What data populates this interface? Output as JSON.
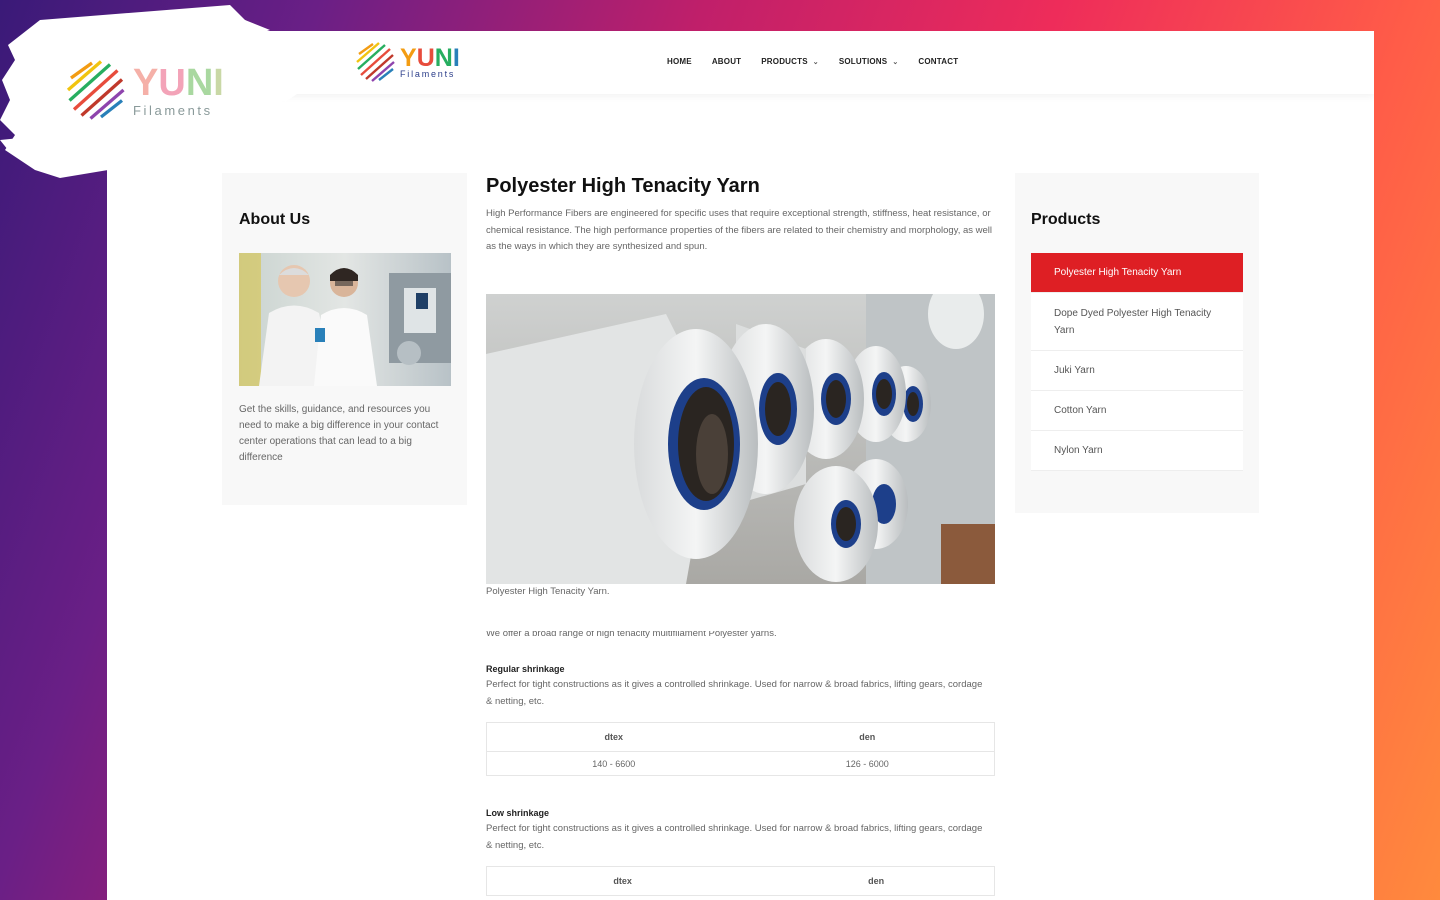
{
  "brand": {
    "name": "YUNI",
    "sub": "Filaments",
    "colors": {
      "y": "#f39c12",
      "u": "#e74c3c",
      "n": "#27ae60",
      "i": "#2980b9",
      "text": "#2c3e8a",
      "accent": "#de1f24"
    }
  },
  "nav": {
    "items": [
      {
        "label": "HOME",
        "dropdown": false
      },
      {
        "label": "ABOUT",
        "dropdown": false
      },
      {
        "label": "PRODUCTS",
        "dropdown": true
      },
      {
        "label": "SOLUTIONS",
        "dropdown": true
      },
      {
        "label": "CONTACT",
        "dropdown": false
      }
    ]
  },
  "about": {
    "title": "About Us",
    "text": "Get the skills, guidance, and resources you need to make a big difference in your contact center operations that can lead to a big difference"
  },
  "main": {
    "title": "Polyester High Tenacity Yarn",
    "intro": "High Performance Fibers are engineered for specific uses that require exceptional strength, stiffness, heat resistance, or chemical resistance. The high performance properties of the fibers are related to their chemistry and morphology, as well as the ways in which they are synthesized and spun.",
    "caption": "Polyester High Tenacity Yarn.",
    "offer": "We offer a broad range of high tenacity multifilament Polyester yarns.",
    "sections": [
      {
        "title": "Regular shrinkage",
        "text": "Perfect for tight constructions as it gives a controlled shrinkage. Used for narrow & broad fabrics, lifting gears, cordage & netting, etc.",
        "headers": [
          "dtex",
          "den"
        ],
        "values": [
          "140 - 6600",
          "126 - 6000"
        ]
      },
      {
        "title": "Low shrinkage",
        "text": "Perfect for tight constructions as it gives a controlled shrinkage. Used for narrow & broad fabrics, lifting gears, cordage & netting, etc.",
        "headers": [
          "dtex",
          "den"
        ]
      }
    ]
  },
  "products": {
    "title": "Products",
    "items": [
      "Polyester High Tenacity Yarn",
      "Dope Dyed Polyester High Tenacity Yarn",
      "Juki Yarn",
      "Cotton Yarn",
      "Nylon Yarn"
    ],
    "active_index": 0
  }
}
